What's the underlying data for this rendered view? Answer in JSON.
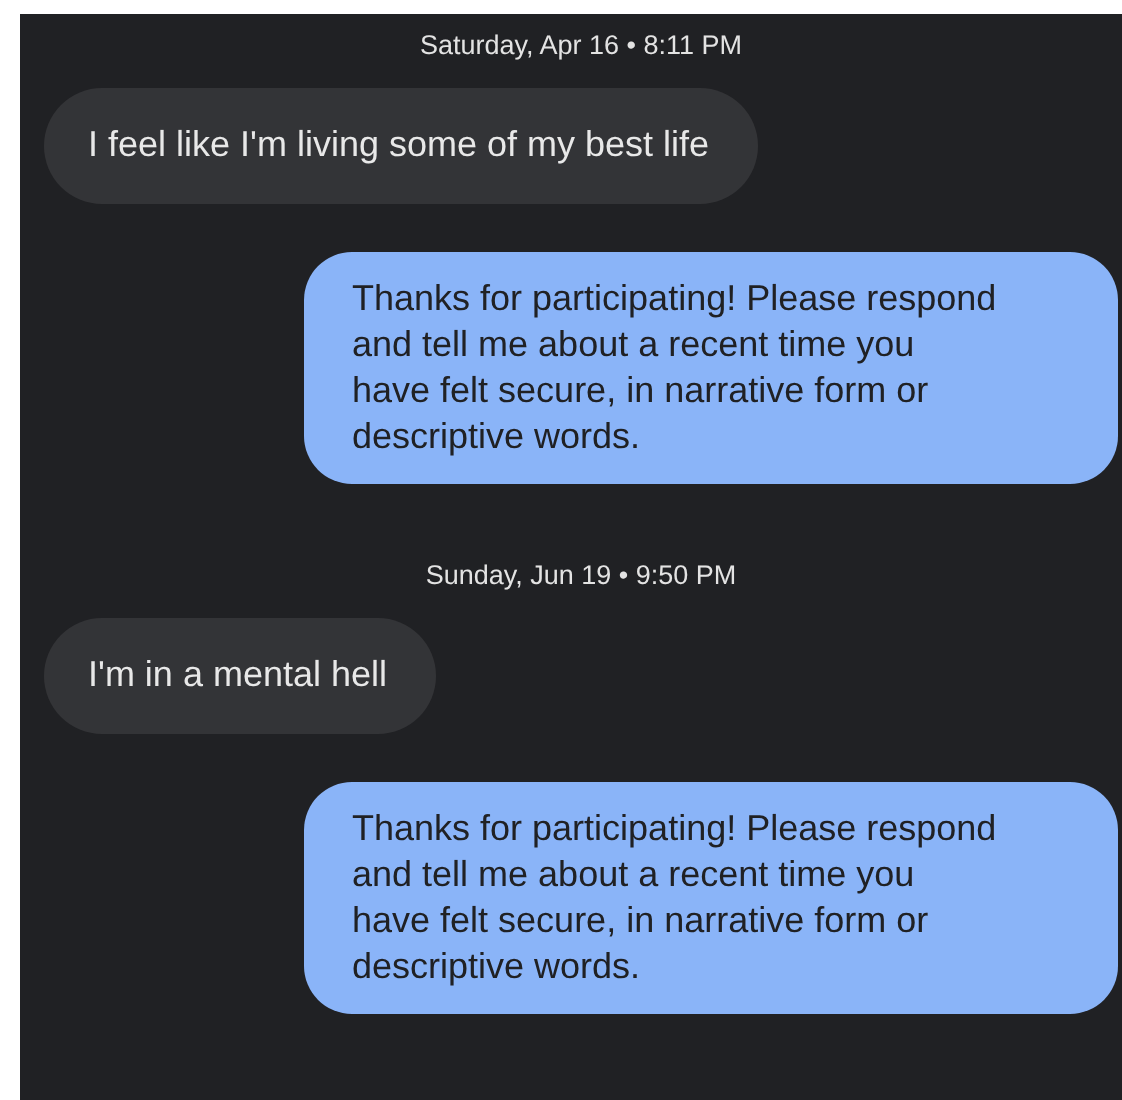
{
  "messages": [
    {
      "kind": "timestamp",
      "text": "Saturday, Apr 16 • 8:11 PM"
    },
    {
      "kind": "incoming",
      "text": "I feel like I'm living some of my best life"
    },
    {
      "kind": "outgoing",
      "text": "Thanks for participating! Please respond\nand tell me about a recent time you\nhave felt secure, in narrative form or\ndescriptive words."
    },
    {
      "kind": "timestamp",
      "text": "Sunday, Jun 19 • 9:50 PM"
    },
    {
      "kind": "incoming",
      "text": "I'm in a mental hell"
    },
    {
      "kind": "outgoing",
      "text": "Thanks for participating! Please respond\nand tell me about a recent time you\nhave felt secure, in narrative form or\ndescriptive words."
    }
  ]
}
